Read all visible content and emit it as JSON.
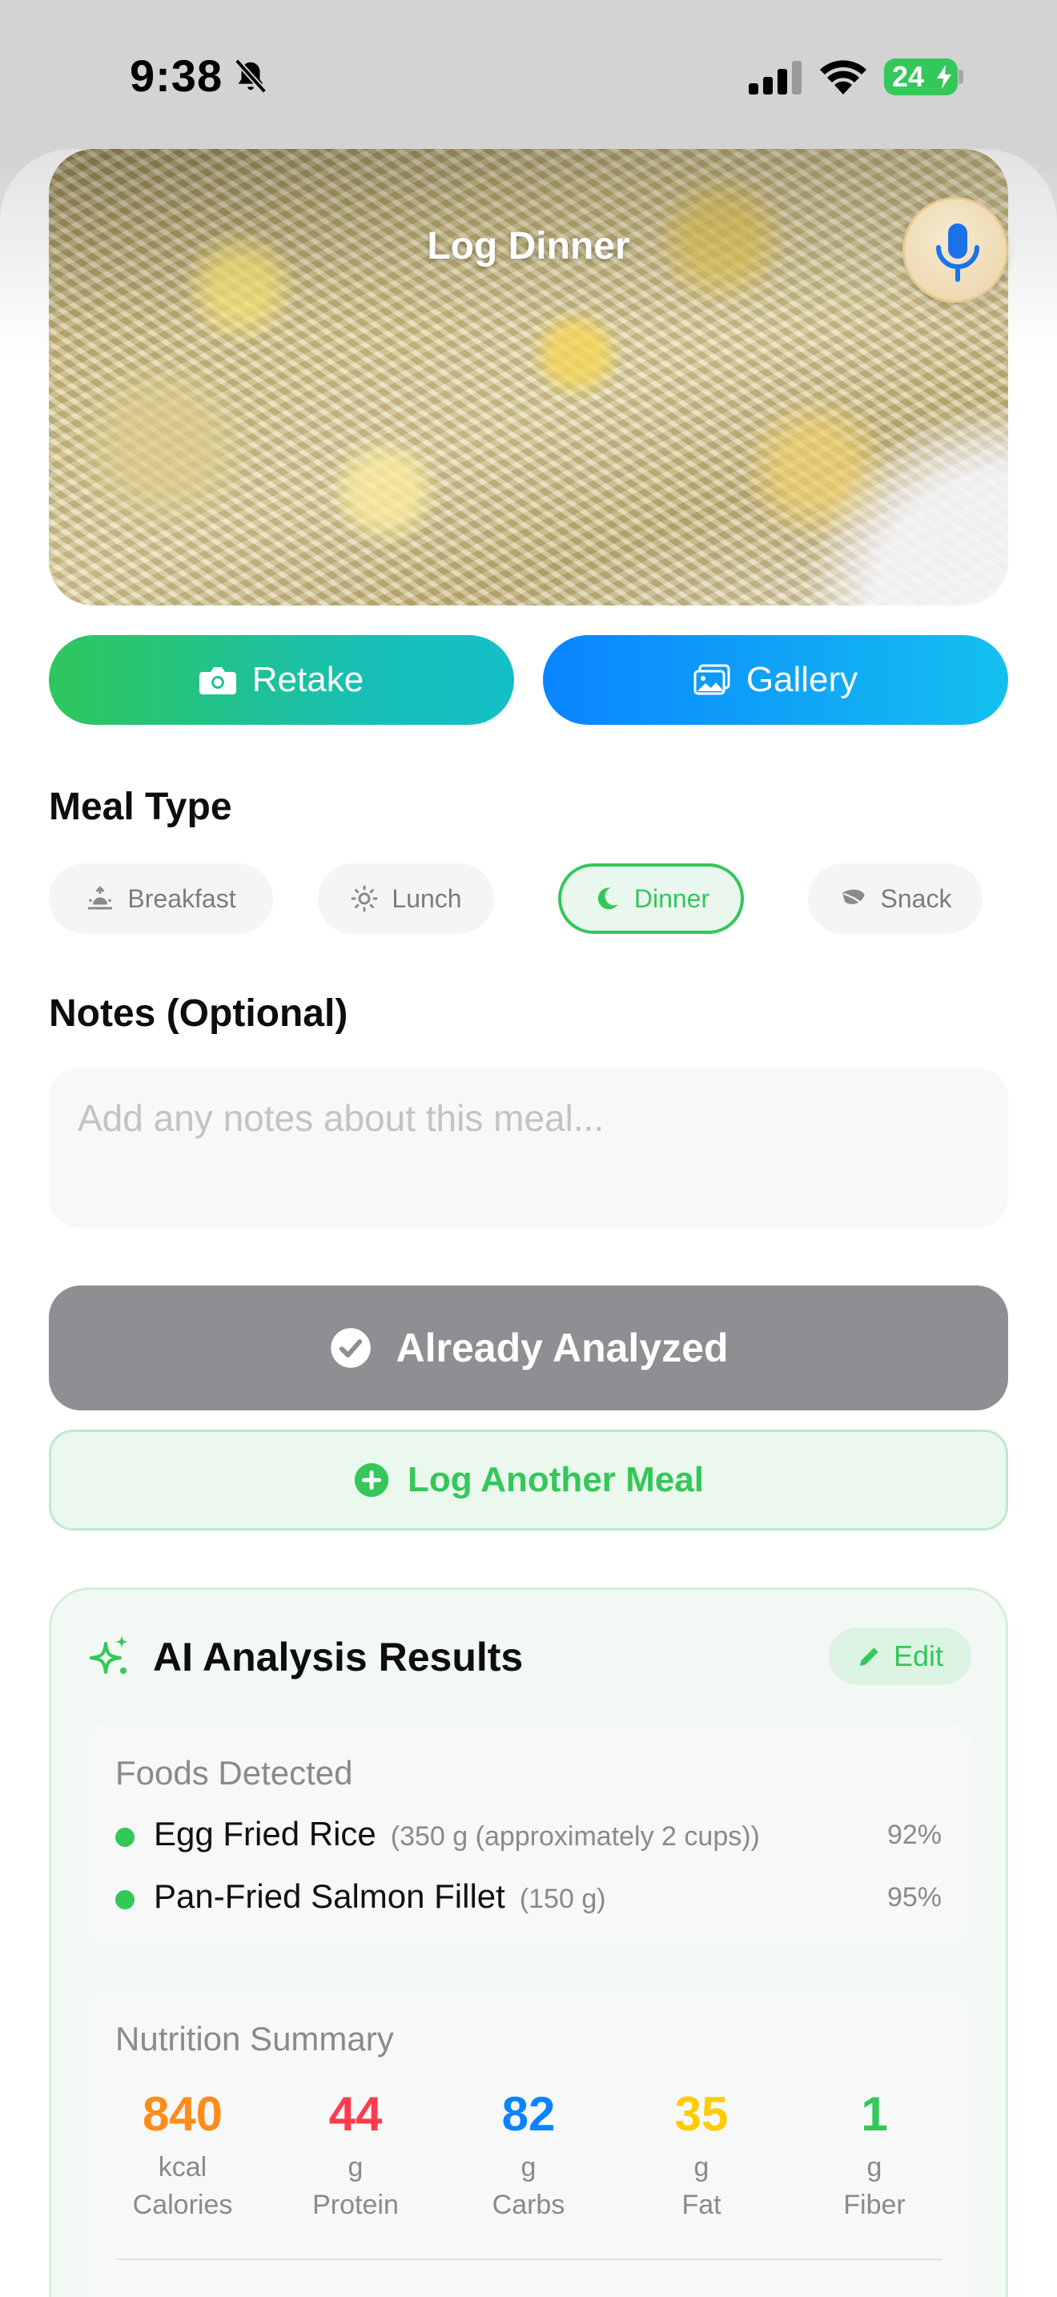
{
  "status_bar": {
    "time": "9:38",
    "battery": "24"
  },
  "header": {
    "title": "Log Dinner"
  },
  "photo_actions": {
    "retake_label": "Retake",
    "gallery_label": "Gallery"
  },
  "meal_type": {
    "title": "Meal Type",
    "options": [
      {
        "label": "Breakfast",
        "icon": "sunrise-icon"
      },
      {
        "label": "Lunch",
        "icon": "sun-icon"
      },
      {
        "label": "Dinner",
        "icon": "moon-icon",
        "selected": true
      },
      {
        "label": "Snack",
        "icon": "leaf-icon"
      }
    ]
  },
  "notes": {
    "title": "Notes (Optional)",
    "placeholder": "Add any notes about this meal...",
    "value": ""
  },
  "actions": {
    "analyzed_label": "Already Analyzed",
    "log_another_label": "Log Another Meal"
  },
  "results": {
    "title": "AI Analysis Results",
    "edit_label": "Edit",
    "foods_title": "Foods Detected",
    "foods": [
      {
        "name": "Egg Fried Rice",
        "quantity": "(350 g (approximately 2 cups))",
        "confidence": "92%"
      },
      {
        "name": "Pan-Fried Salmon Fillet",
        "quantity": "(150 g)",
        "confidence": "95%"
      }
    ],
    "nutrition_title": "Nutrition Summary",
    "nutrition": [
      {
        "value": "840",
        "unit": "kcal",
        "label": "Calories",
        "color": "#ff8c1a"
      },
      {
        "value": "44",
        "unit": "g",
        "label": "Protein",
        "color": "#ff3b4e"
      },
      {
        "value": "82",
        "unit": "g",
        "label": "Carbs",
        "color": "#0a84ff"
      },
      {
        "value": "35",
        "unit": "g",
        "label": "Fat",
        "color": "#ffcc00"
      },
      {
        "value": "1",
        "unit": "g",
        "label": "Fiber",
        "color": "#34c759"
      }
    ]
  },
  "colors": {
    "accent_green": "#34c759",
    "accent_blue": "#0a84ff",
    "disabled_gray": "#8e8e93"
  }
}
